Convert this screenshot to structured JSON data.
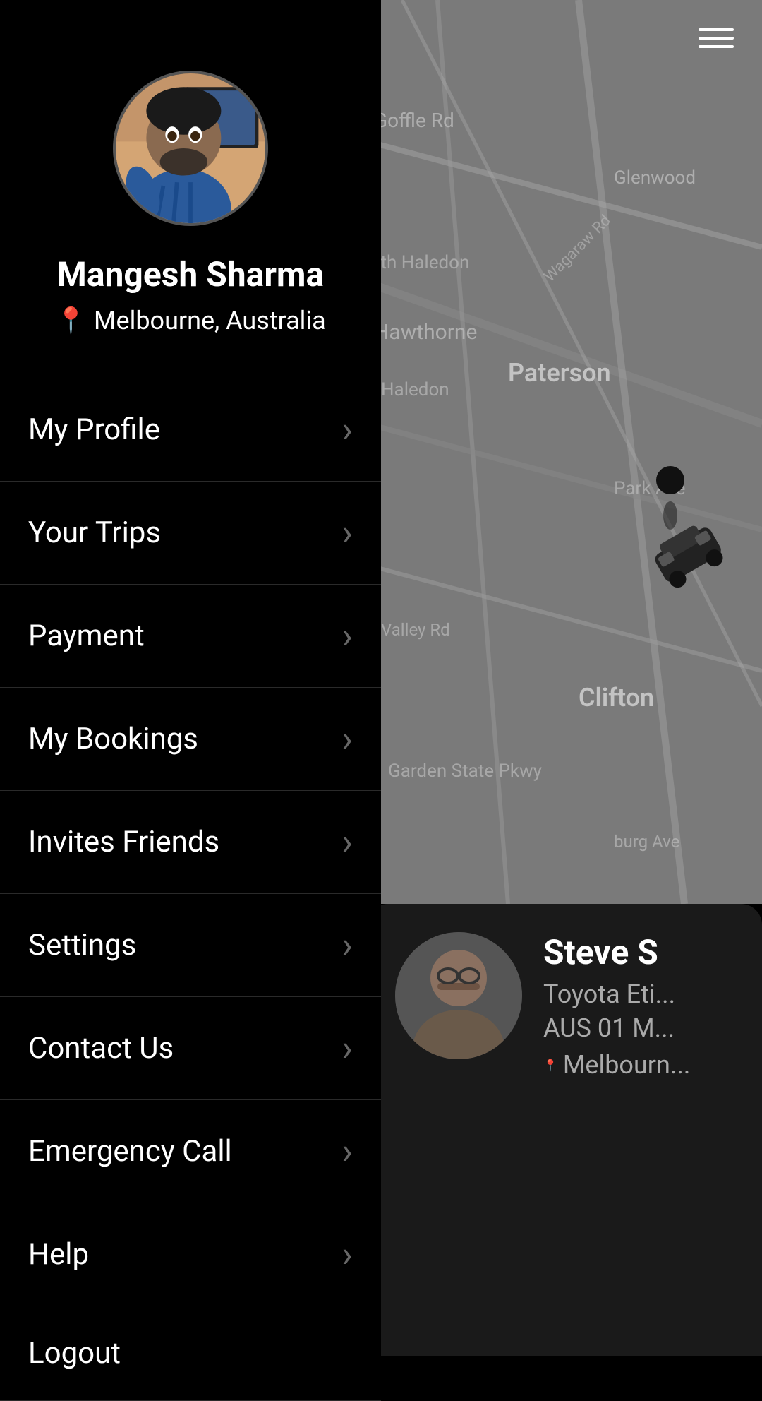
{
  "header": {
    "hamburger_label": "Menu"
  },
  "profile": {
    "name": "Mangesh Sharma",
    "location": "Melbourne, Australia"
  },
  "menu": {
    "items": [
      {
        "id": "my-profile",
        "label": "My Profile",
        "has_arrow": true
      },
      {
        "id": "your-trips",
        "label": "Your Trips",
        "has_arrow": true
      },
      {
        "id": "payment",
        "label": "Payment",
        "has_arrow": true
      },
      {
        "id": "my-bookings",
        "label": "My Bookings",
        "has_arrow": true
      },
      {
        "id": "invites-friends",
        "label": "Invites Friends",
        "has_arrow": true
      },
      {
        "id": "settings",
        "label": "Settings",
        "has_arrow": true
      },
      {
        "id": "contact-us",
        "label": "Contact Us",
        "has_arrow": true
      },
      {
        "id": "emergency-call",
        "label": "Emergency Call",
        "has_arrow": true
      },
      {
        "id": "help",
        "label": "Help",
        "has_arrow": true
      },
      {
        "id": "logout",
        "label": "Logout",
        "has_arrow": false
      }
    ]
  },
  "driver": {
    "name": "Steve S",
    "car": "Toyota Eti...",
    "plate": "AUS 01 M...",
    "location": "Melbourn..."
  }
}
